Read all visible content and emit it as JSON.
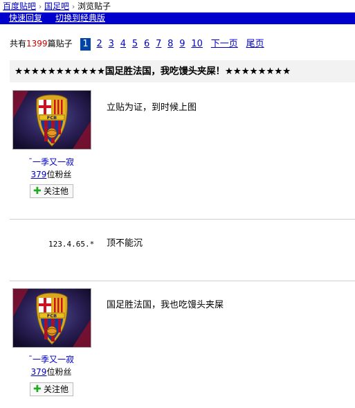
{
  "breadcrumb": {
    "items": [
      "百度贴吧",
      "国足吧",
      "浏览贴子"
    ],
    "separator": "›"
  },
  "bluebar": {
    "links": [
      "快速回复",
      "切换到经典版"
    ]
  },
  "pager": {
    "prefix": "共有",
    "count": "1399",
    "suffix": "篇贴子",
    "pages": [
      "1",
      "2",
      "3",
      "4",
      "5",
      "6",
      "7",
      "8",
      "9",
      "10"
    ],
    "current": "1",
    "next": "下一页",
    "last": "尾页"
  },
  "thread": {
    "title": "★★★★★★★★★★★国足胜法国，我吃馒头夹屎！★★★★★★★★"
  },
  "posts": [
    {
      "author": "¯一季又一寂",
      "fans_count": "379",
      "fans_suffix": "位粉丝",
      "follow_label": "关注他",
      "content": "立贴为证，到时候上图"
    },
    {
      "ip": "123.4.65.*",
      "content": "顶不能沉"
    },
    {
      "author": "¯一季又一寂",
      "fans_count": "379",
      "fans_suffix": "位粉丝",
      "follow_label": "关注他",
      "content": "国足胜法国，我也吃馒头夹屎"
    }
  ],
  "colors": {
    "link": "#0000cc",
    "bar": "#0000cc",
    "count": "#cc0000",
    "current_page": "#0044aa",
    "title_bg": "#f2f2f2"
  },
  "avatar_icon": "fcb-crest-icon",
  "avatar_text": "FCB"
}
